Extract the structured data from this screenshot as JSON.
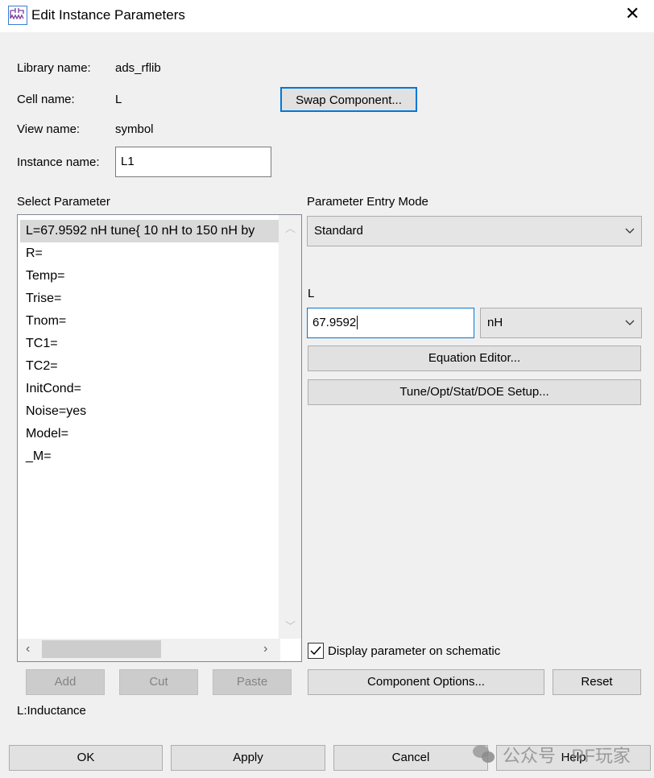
{
  "window": {
    "title": "Edit Instance Parameters",
    "close_icon": "close-icon",
    "app_icon": "inductor-schematic-icon"
  },
  "info": {
    "library_label": "Library name:",
    "library_value": "ads_rflib",
    "cell_label": "Cell name:",
    "cell_value": "L",
    "view_label": "View name:",
    "view_value": "symbol",
    "instance_label": "Instance name:",
    "instance_value": "L1"
  },
  "swap_button": "Swap Component...",
  "select_parameter": {
    "label": "Select Parameter",
    "items": [
      "L=67.9592 nH tune{ 10 nH to 150 nH by",
      "R=",
      "Temp=",
      "Trise=",
      "Tnom=",
      "TC1=",
      "TC2=",
      "InitCond=",
      "Noise=yes",
      "Model=",
      "_M="
    ],
    "selected": 0
  },
  "entry_mode": {
    "label": "Parameter Entry Mode",
    "value": "Standard"
  },
  "param": {
    "label": "L",
    "value": "67.9592",
    "unit": "nH"
  },
  "equation_editor": "Equation Editor...",
  "tune_setup": "Tune/Opt/Stat/DOE Setup...",
  "display_checkbox": {
    "label": "Display parameter on schematic",
    "checked": true
  },
  "list_buttons": {
    "add": "Add",
    "cut": "Cut",
    "paste": "Paste"
  },
  "component_options": "Component Options...",
  "reset": "Reset",
  "description": "L:Inductance",
  "footer": {
    "ok": "OK",
    "apply": "Apply",
    "cancel": "Cancel",
    "help": "Help"
  },
  "watermark": "公众号 · RF玩家"
}
